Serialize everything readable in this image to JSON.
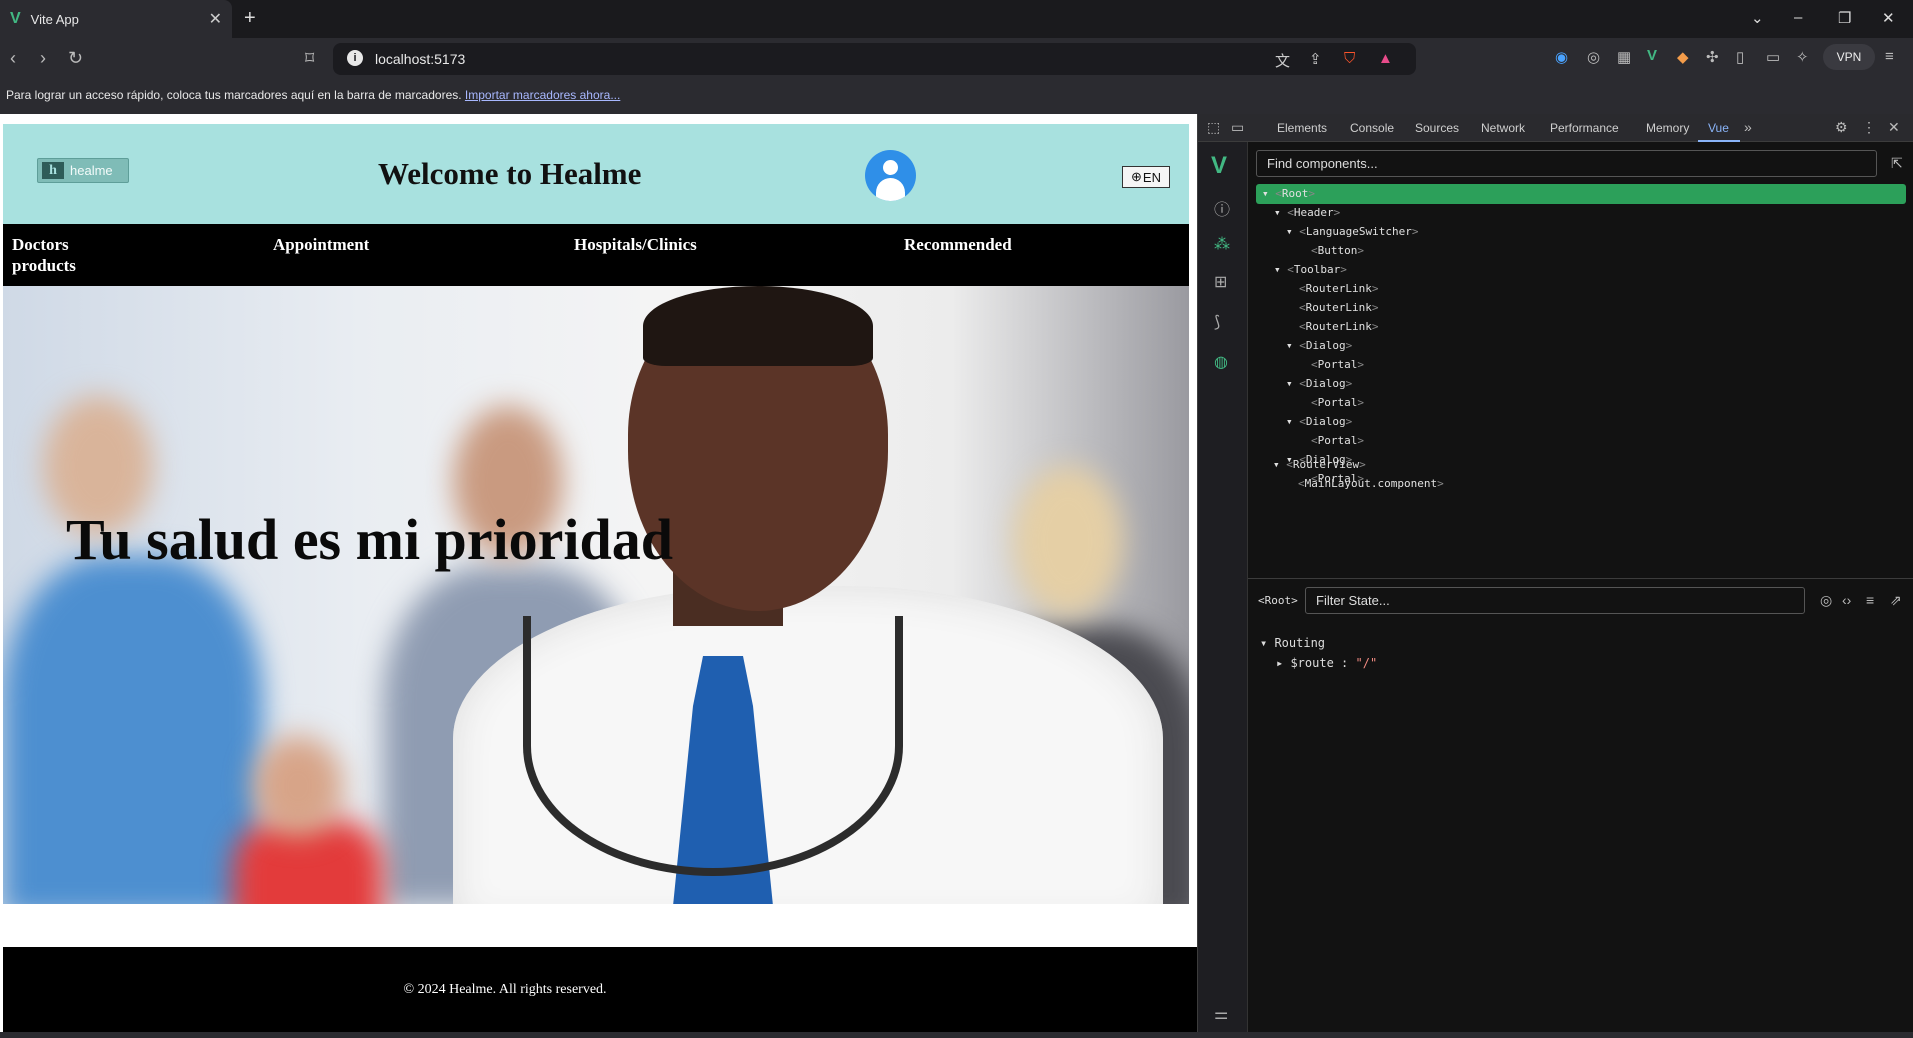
{
  "browser": {
    "tab_title": "Vite App",
    "url": "localhost:5173",
    "bookmarks_text": "Para lograr un acceso rápido, coloca tus marcadores aquí en la barra de marcadores.",
    "bookmarks_link": "Importar marcadores ahora...",
    "vpn_label": "VPN"
  },
  "site": {
    "logo_text": "healme",
    "title": "Welcome to Healme",
    "lang_button": "EN",
    "nav": [
      "Doctors products",
      "Appointment",
      "Hospitals/Clinics",
      "Recommended"
    ],
    "hero_text": "Tu salud es mi prioridad",
    "footer": "© 2024 Healme. All rights reserved."
  },
  "devtools": {
    "tabs": [
      "Elements",
      "Console",
      "Sources",
      "Network",
      "Performance",
      "Memory",
      "Vue"
    ],
    "active_tab": "Vue",
    "find_placeholder": "Find components...",
    "tree": [
      "Root",
      "Header",
      "LanguageSwitcher",
      "Button",
      "Toolbar",
      "RouterLink",
      "RouterLink",
      "RouterLink",
      "Dialog",
      "Portal",
      "Dialog",
      "Portal",
      "Dialog",
      "Portal",
      "Dialog",
      "Portal",
      "Dialog",
      "Portal",
      "RouterView",
      "MainLayout.component"
    ],
    "selected_label": "Root",
    "filter_placeholder": "Filter State...",
    "state_section": "Routing",
    "state_key": "$route",
    "state_value": "\"/\""
  },
  "colors": {
    "header_bg": "#a8e1df",
    "nav_bg": "#000000",
    "vue_green": "#42b883",
    "selected_row": "#2ca05a"
  }
}
